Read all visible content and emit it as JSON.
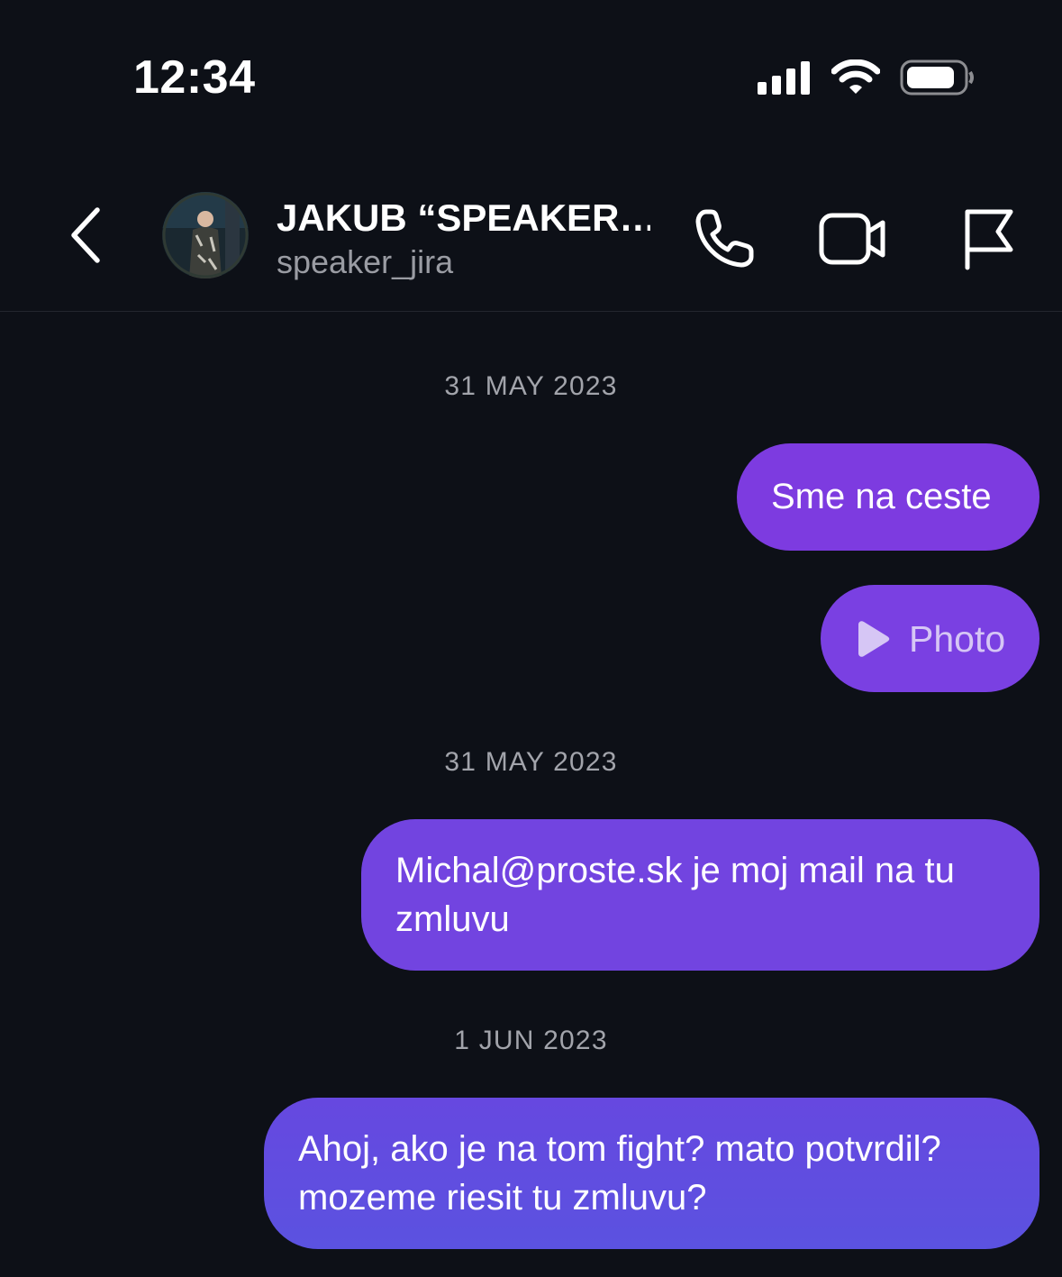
{
  "status_bar": {
    "time": "12:34"
  },
  "header": {
    "contact_name": "JAKUB “SPEAKER…",
    "username": "speaker_jira",
    "icons": [
      "chevron-left-icon",
      "phone-icon",
      "video-camera-icon",
      "flag-icon"
    ]
  },
  "messages": [
    {
      "date": "31 MAY 2023",
      "items": [
        {
          "kind": "text",
          "text": "Sme na ceste",
          "color": "#7d3be0"
        },
        {
          "kind": "photo",
          "label": "Photo",
          "color": "#7a40e2"
        }
      ]
    },
    {
      "date": "31 MAY 2023",
      "items": [
        {
          "kind": "text",
          "text": "Michal@proste.sk je moj mail na tu zmluvu",
          "color": "#7244e0"
        }
      ]
    },
    {
      "date": "1 JUN 2023",
      "items": [
        {
          "kind": "text",
          "text": "Ahoj, ako je na tom fight? mato potvrdil? mozeme riesit tu zmluvu?",
          "color": "#5f4ee0"
        }
      ]
    }
  ],
  "colors": {
    "background": "#0d1017",
    "bubble_top": "#7d3be0",
    "bubble_bottom": "#5b52e0"
  }
}
